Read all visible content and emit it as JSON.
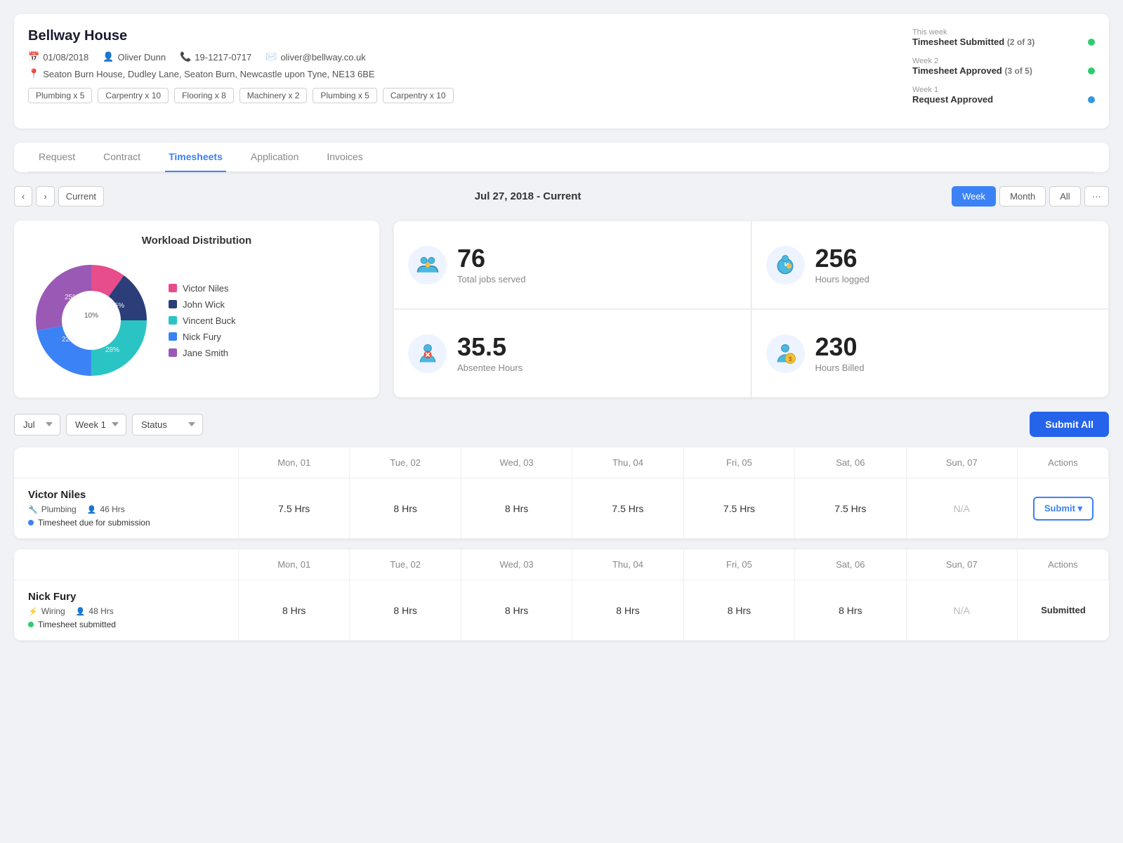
{
  "project": {
    "title": "Bellway House",
    "date": "01/08/2018",
    "manager": "Oliver Dunn",
    "phone": "19-1217-0717",
    "email": "oliver@bellway.co.uk",
    "address": "Seaton Burn House, Dudley Lane, Seaton Burn, Newcastle upon Tyne, NE13 6BE",
    "tags": [
      "Plumbing x 5",
      "Carpentry x 10",
      "Flooring x 8",
      "Machinery x 2",
      "Plumbing x 5",
      "Carpentry x 10"
    ]
  },
  "status_timeline": [
    {
      "week": "This week",
      "label": "Timesheet Submitted",
      "count": "(2 of 3)",
      "dot": "green"
    },
    {
      "week": "Week 2",
      "label": "Timesheet Approved",
      "count": "(3 of 5)",
      "dot": "green"
    },
    {
      "week": "Week 1",
      "label": "Request Approved",
      "count": "",
      "dot": "blue"
    }
  ],
  "tabs": [
    "Request",
    "Contract",
    "Timesheets",
    "Application",
    "Invoices"
  ],
  "active_tab": "Timesheets",
  "period": {
    "label": "Jul 27, 2018 - Current",
    "current_btn": "Current",
    "views": [
      "Week",
      "Month",
      "All"
    ]
  },
  "workload": {
    "title": "Workload Distribution",
    "segments": [
      {
        "name": "Victor Niles",
        "color": "#e74c8b",
        "percent": 10
      },
      {
        "name": "John Wick",
        "color": "#2c3e7a",
        "percent": 15
      },
      {
        "name": "Vincent Buck",
        "color": "#2bc4c4",
        "percent": 25
      },
      {
        "name": "Nick Fury",
        "color": "#3b82f6",
        "percent": 22
      },
      {
        "name": "Jane Smith",
        "color": "#9b59b6",
        "percent": 28
      }
    ]
  },
  "stats": [
    {
      "number": "76",
      "label": "Total jobs served",
      "icon": "👥"
    },
    {
      "number": "256",
      "label": "Hours logged",
      "icon": "⏱"
    },
    {
      "number": "35.5",
      "label": "Absentee Hours",
      "icon": "🚫"
    },
    {
      "number": "230",
      "label": "Hours Billed",
      "icon": "💰"
    }
  ],
  "filters": {
    "month": "Jul",
    "week": "Week 1",
    "status": "Status"
  },
  "submit_all_label": "Submit All",
  "days": [
    "Mon, 01",
    "Tue, 02",
    "Wed, 03",
    "Thu, 04",
    "Fri, 05",
    "Sat, 06",
    "Sun, 07"
  ],
  "workers": [
    {
      "name": "Victor Niles",
      "trade": "Plumbing",
      "hours": "46 Hrs",
      "status": "Timesheet due for submission",
      "status_dot": "blue",
      "hours_per_day": [
        "7.5 Hrs",
        "8 Hrs",
        "8 Hrs",
        "7.5 Hrs",
        "7.5 Hrs",
        "7.5 Hrs",
        "N/A"
      ],
      "action": "submit"
    },
    {
      "name": "Nick Fury",
      "trade": "Wiring",
      "hours": "48 Hrs",
      "status": "Timesheet submitted",
      "status_dot": "green",
      "hours_per_day": [
        "8 Hrs",
        "8 Hrs",
        "8 Hrs",
        "8 Hrs",
        "8 Hrs",
        "8 Hrs",
        "N/A"
      ],
      "action": "submitted"
    }
  ],
  "actions_label": "Actions"
}
